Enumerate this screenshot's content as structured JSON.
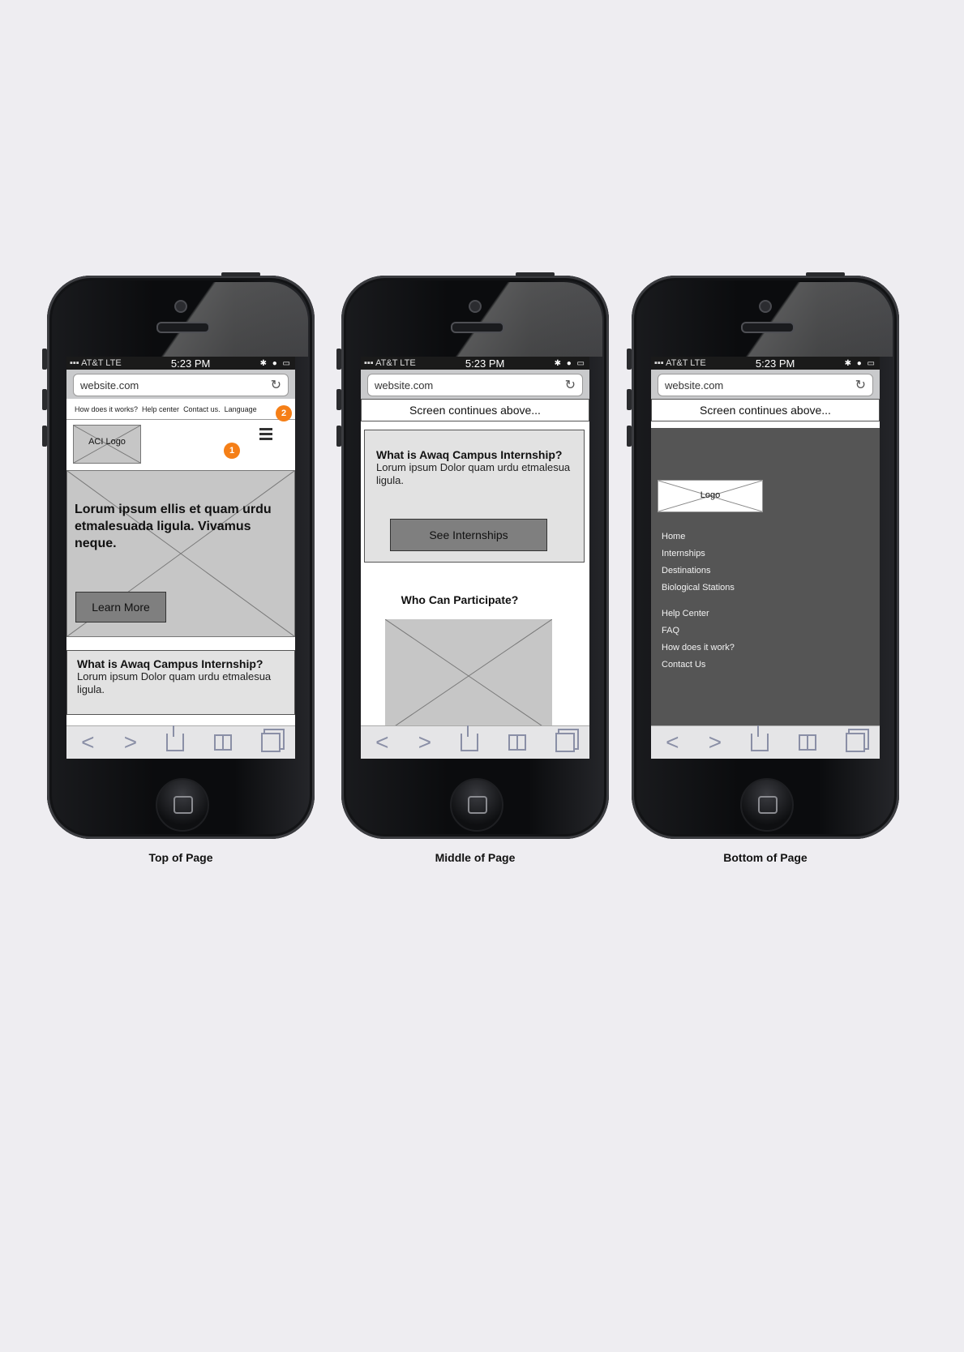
{
  "status": {
    "carrier": "AT&T LTE",
    "time": "5:23 PM"
  },
  "url": "website.com",
  "captions": {
    "top": "Top of Page",
    "middle": "Middle of Page",
    "bottom": "Bottom of Page"
  },
  "top": {
    "nav": [
      "How does it works?",
      "Help center",
      "Contact us.",
      "Language"
    ],
    "logo": "ACI Logo",
    "badge1": "1",
    "badge2": "2",
    "hero_title": "Lorum ipsum ellis et quam urdu etmalesuada ligula. Vivamus neque.",
    "learn_more": "Learn More",
    "section_title": "What is Awaq Campus Internship?",
    "section_text": "Lorum ipsum Dolor quam urdu etmalesua ligula."
  },
  "middle": {
    "continues": "Screen continues above...",
    "section_title": "What is Awaq Campus Internship?",
    "section_text": "Lorum ipsum Dolor quam urdu etmalesua ligula.",
    "see_internships": "See Internships",
    "who_title": "Who Can Participate?"
  },
  "bottom": {
    "continues": "Screen continues above...",
    "logo": "Logo",
    "menu": [
      "Home",
      "Internships",
      "Destinations",
      "Biological Stations"
    ],
    "menu2": [
      "Help Center",
      "FAQ",
      "How does it work?",
      "Contact Us"
    ]
  }
}
